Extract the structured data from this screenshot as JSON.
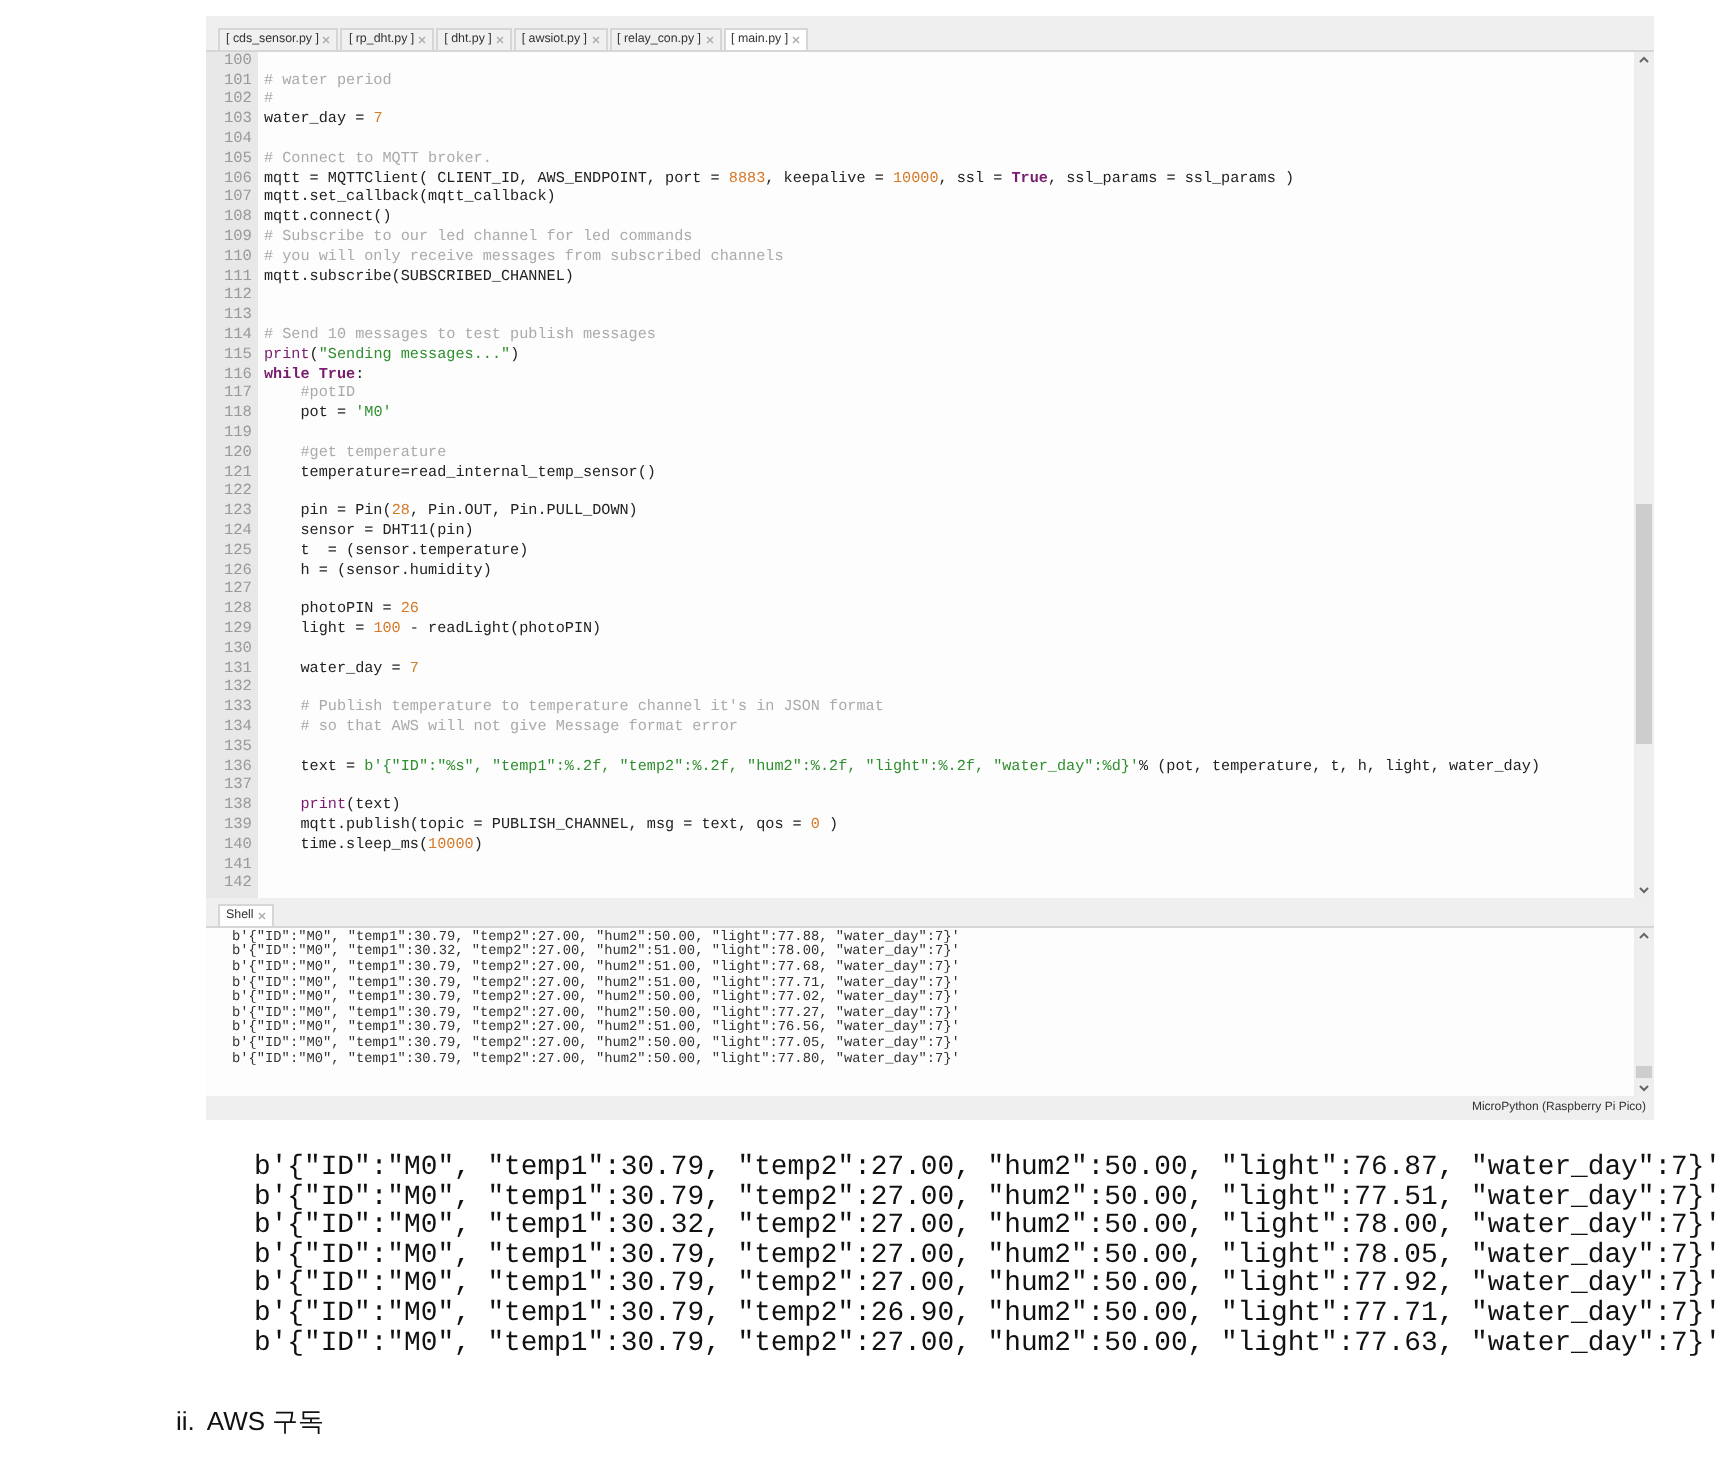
{
  "tabs": [
    {
      "label": "[ cds_sensor.py ]",
      "selected": false
    },
    {
      "label": "[ rp_dht.py ]",
      "selected": false
    },
    {
      "label": "[ dht.py ]",
      "selected": false
    },
    {
      "label": "[ awsiot.py ]",
      "selected": false
    },
    {
      "label": "[ relay_con.py ]",
      "selected": false
    },
    {
      "label": "[ main.py ]",
      "selected": true
    }
  ],
  "editor": {
    "lines": [
      {
        "number": "100"
      },
      {
        "number": "101",
        "parts": [
          {
            "kind": "comment",
            "text": "# water period"
          }
        ]
      },
      {
        "number": "102",
        "parts": [
          {
            "kind": "comment",
            "text": "#"
          }
        ]
      },
      {
        "number": "103",
        "parts": [
          {
            "kind": "plain",
            "text": "water_day = "
          },
          {
            "kind": "number",
            "text": "7"
          }
        ]
      },
      {
        "number": "104"
      },
      {
        "number": "105",
        "parts": [
          {
            "kind": "comment",
            "text": "# Connect to MQTT broker."
          }
        ]
      },
      {
        "number": "106",
        "parts": [
          {
            "kind": "plain",
            "text": "mqtt = MQTTClient( CLIENT_ID, AWS_ENDPOINT, port = "
          },
          {
            "kind": "number",
            "text": "8883"
          },
          {
            "kind": "plain",
            "text": ", keepalive = "
          },
          {
            "kind": "number",
            "text": "10000"
          },
          {
            "kind": "plain",
            "text": ", ssl = "
          },
          {
            "kind": "keyword",
            "text": "True"
          },
          {
            "kind": "plain",
            "text": ", ssl_params = ssl_params )"
          }
        ]
      },
      {
        "number": "107",
        "parts": [
          {
            "kind": "plain",
            "text": "mqtt.set_callback(mqtt_callback)"
          }
        ]
      },
      {
        "number": "108",
        "parts": [
          {
            "kind": "plain",
            "text": "mqtt.connect()"
          }
        ]
      },
      {
        "number": "109",
        "parts": [
          {
            "kind": "comment",
            "text": "# Subscribe to our led channel for led commands"
          }
        ]
      },
      {
        "number": "110",
        "parts": [
          {
            "kind": "comment",
            "text": "# you will only receive messages from subscribed channels"
          }
        ]
      },
      {
        "number": "111",
        "parts": [
          {
            "kind": "plain",
            "text": "mqtt.subscribe(SUBSCRIBED_CHANNEL)"
          }
        ]
      },
      {
        "number": "112"
      },
      {
        "number": "113"
      },
      {
        "number": "114",
        "parts": [
          {
            "kind": "comment",
            "text": "# Send 10 messages to test publish messages"
          }
        ]
      },
      {
        "number": "115",
        "parts": [
          {
            "kind": "builtin",
            "text": "print"
          },
          {
            "kind": "plain",
            "text": "("
          },
          {
            "kind": "string",
            "text": "\"Sending messages...\""
          },
          {
            "kind": "plain",
            "text": ")"
          }
        ]
      },
      {
        "number": "116",
        "parts": [
          {
            "kind": "keyword",
            "text": "while "
          },
          {
            "kind": "keyword",
            "text": "True"
          },
          {
            "kind": "plain",
            "text": ":"
          }
        ]
      },
      {
        "number": "117",
        "parts": [
          {
            "kind": "comment",
            "text": "    #potID"
          }
        ]
      },
      {
        "number": "118",
        "parts": [
          {
            "kind": "plain",
            "text": "    pot = "
          },
          {
            "kind": "string",
            "text": "'M0'"
          }
        ]
      },
      {
        "number": "119"
      },
      {
        "number": "120",
        "parts": [
          {
            "kind": "comment",
            "text": "    #get temperature"
          }
        ]
      },
      {
        "number": "121",
        "parts": [
          {
            "kind": "plain",
            "text": "    temperature=read_internal_temp_sensor()"
          }
        ]
      },
      {
        "number": "122"
      },
      {
        "number": "123",
        "parts": [
          {
            "kind": "plain",
            "text": "    pin = Pin("
          },
          {
            "kind": "number",
            "text": "28"
          },
          {
            "kind": "plain",
            "text": ", Pin.OUT, Pin.PULL_DOWN)"
          }
        ]
      },
      {
        "number": "124",
        "parts": [
          {
            "kind": "plain",
            "text": "    sensor = DHT11(pin)"
          }
        ]
      },
      {
        "number": "125",
        "parts": [
          {
            "kind": "plain",
            "text": "    t  = (sensor.temperature)"
          }
        ]
      },
      {
        "number": "126",
        "parts": [
          {
            "kind": "plain",
            "text": "    h = (sensor.humidity)"
          }
        ]
      },
      {
        "number": "127"
      },
      {
        "number": "128",
        "parts": [
          {
            "kind": "plain",
            "text": "    photoPIN = "
          },
          {
            "kind": "number",
            "text": "26"
          }
        ]
      },
      {
        "number": "129",
        "parts": [
          {
            "kind": "plain",
            "text": "    light = "
          },
          {
            "kind": "number",
            "text": "100"
          },
          {
            "kind": "plain",
            "text": " - readLight(photoPIN)"
          }
        ]
      },
      {
        "number": "130"
      },
      {
        "number": "131",
        "parts": [
          {
            "kind": "plain",
            "text": "    water_day = "
          },
          {
            "kind": "number",
            "text": "7"
          }
        ]
      },
      {
        "number": "132"
      },
      {
        "number": "133",
        "parts": [
          {
            "kind": "comment",
            "text": "    # Publish temperature to temperature channel it's in JSON format"
          }
        ]
      },
      {
        "number": "134",
        "parts": [
          {
            "kind": "comment",
            "text": "    # so that AWS will not give Message format error"
          }
        ]
      },
      {
        "number": "135"
      },
      {
        "number": "136",
        "parts": [
          {
            "kind": "plain",
            "text": "    text = "
          },
          {
            "kind": "string",
            "text": "b'{\"ID\":\"%s\", \"temp1\":%.2f, \"temp2\":%.2f, \"hum2\":%.2f, \"light\":%.2f, \"water_day\":%d}'"
          },
          {
            "kind": "plain",
            "text": "% (pot, temperature, t, h, light, water_day)"
          }
        ]
      },
      {
        "number": "137"
      },
      {
        "number": "138",
        "parts": [
          {
            "kind": "builtin",
            "text": "    print"
          },
          {
            "kind": "plain",
            "text": "(text)"
          }
        ]
      },
      {
        "number": "139",
        "parts": [
          {
            "kind": "plain",
            "text": "    mqtt.publish(topic = PUBLISH_CHANNEL, msg = text, qos = "
          },
          {
            "kind": "number",
            "text": "0"
          },
          {
            "kind": "plain",
            "text": " )"
          }
        ]
      },
      {
        "number": "140",
        "parts": [
          {
            "kind": "plain",
            "text": "    time.sleep_ms("
          },
          {
            "kind": "number",
            "text": "10000"
          },
          {
            "kind": "plain",
            "text": ")"
          }
        ]
      },
      {
        "number": "141"
      },
      {
        "number": "142"
      }
    ]
  },
  "shell": {
    "title": "Shell",
    "lines": [
      "b'{\"ID\":\"M0\", \"temp1\":30.79, \"temp2\":27.00, \"hum2\":50.00, \"light\":77.88, \"water_day\":7}'",
      "b'{\"ID\":\"M0\", \"temp1\":30.32, \"temp2\":27.00, \"hum2\":51.00, \"light\":78.00, \"water_day\":7}'",
      "b'{\"ID\":\"M0\", \"temp1\":30.79, \"temp2\":27.00, \"hum2\":51.00, \"light\":77.68, \"water_day\":7}'",
      "b'{\"ID\":\"M0\", \"temp1\":30.79, \"temp2\":27.00, \"hum2\":51.00, \"light\":77.71, \"water_day\":7}'",
      "b'{\"ID\":\"M0\", \"temp1\":30.79, \"temp2\":27.00, \"hum2\":50.00, \"light\":77.02, \"water_day\":7}'",
      "b'{\"ID\":\"M0\", \"temp1\":30.79, \"temp2\":27.00, \"hum2\":50.00, \"light\":77.27, \"water_day\":7}'",
      "b'{\"ID\":\"M0\", \"temp1\":30.79, \"temp2\":27.00, \"hum2\":51.00, \"light\":76.56, \"water_day\":7}'",
      "b'{\"ID\":\"M0\", \"temp1\":30.79, \"temp2\":27.00, \"hum2\":50.00, \"light\":77.05, \"water_day\":7}'",
      "b'{\"ID\":\"M0\", \"temp1\":30.79, \"temp2\":27.00, \"hum2\":50.00, \"light\":77.80, \"water_day\":7}'"
    ]
  },
  "status_bar": "MicroPython (Raspberry Pi Pico)",
  "output_lines": [
    "b'{\"ID\":\"M0\", \"temp1\":30.79, \"temp2\":27.00, \"hum2\":50.00, \"light\":76.87, \"water_day\":7}'",
    "b'{\"ID\":\"M0\", \"temp1\":30.79, \"temp2\":27.00, \"hum2\":50.00, \"light\":77.51, \"water_day\":7}'",
    "b'{\"ID\":\"M0\", \"temp1\":30.32, \"temp2\":27.00, \"hum2\":50.00, \"light\":78.00, \"water_day\":7}'",
    "b'{\"ID\":\"M0\", \"temp1\":30.79, \"temp2\":27.00, \"hum2\":50.00, \"light\":78.05, \"water_day\":7}'",
    "b'{\"ID\":\"M0\", \"temp1\":30.79, \"temp2\":27.00, \"hum2\":50.00, \"light\":77.92, \"water_day\":7}'",
    "b'{\"ID\":\"M0\", \"temp1\":30.79, \"temp2\":26.90, \"hum2\":50.00, \"light\":77.71, \"water_day\":7}'",
    "b'{\"ID\":\"M0\", \"temp1\":30.79, \"temp2\":27.00, \"hum2\":50.00, \"light\":77.63, \"water_day\":7}'"
  ],
  "heading": {
    "marker": "ii.",
    "text": "AWS 구독"
  }
}
